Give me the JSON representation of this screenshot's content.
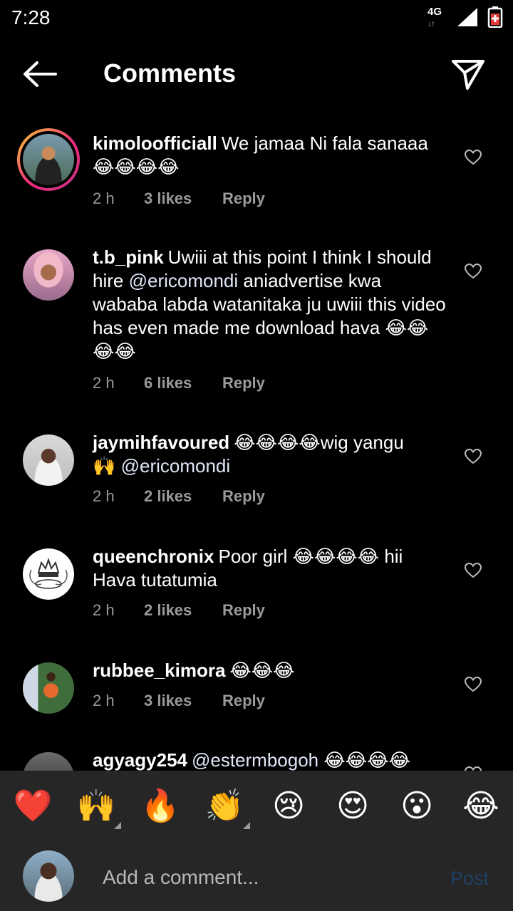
{
  "status": {
    "time": "7:28",
    "network": "4G"
  },
  "header": {
    "title": "Comments"
  },
  "comments": [
    {
      "username": "kimoloofficiall",
      "text": "We jamaa Ni fala sanaaa",
      "emoji": "😂😂😂😂",
      "time": "2 h",
      "likes": "3 likes",
      "reply": "Reply"
    },
    {
      "username": "t.b_pink",
      "text": "Uwiii at this point I think I should hire",
      "mention": "@ericomondi",
      "text2": "aniadvertise kwa wababa labda watanitaka ju uwiii this video has even made me download hava",
      "emoji": "😂😂😂😂",
      "time": "2 h",
      "likes": "6 likes",
      "reply": "Reply"
    },
    {
      "username": "jaymihfavoured",
      "emoji": "😂😂😂😂",
      "text": "wig yangu",
      "emoji2": "🙌",
      "mention": "@ericomondi",
      "time": "2 h",
      "likes": "2 likes",
      "reply": "Reply"
    },
    {
      "username": "queenchronix",
      "text": "Poor girl",
      "emoji": "😂😂😂😂",
      "text2": "hii Hava tutatumia",
      "time": "2 h",
      "likes": "2 likes",
      "reply": "Reply"
    },
    {
      "username": "rubbee_kimora",
      "emoji": "😂😂😂",
      "time": "2 h",
      "likes": "3 likes",
      "reply": "Reply"
    },
    {
      "username": "agyagy254",
      "mention": "@estermbogoh",
      "emoji": "😂😂😂😂"
    }
  ],
  "reactions": [
    "❤️",
    "🙌",
    "🔥",
    "👏",
    "😢",
    "😍",
    "😮",
    "😂"
  ],
  "composer": {
    "placeholder": "Add a comment...",
    "post_label": "Post"
  },
  "colors": {
    "background": "#000000",
    "bar": "#262626",
    "meta": "#9a9a9a",
    "post_disabled": "#1f3f63"
  }
}
